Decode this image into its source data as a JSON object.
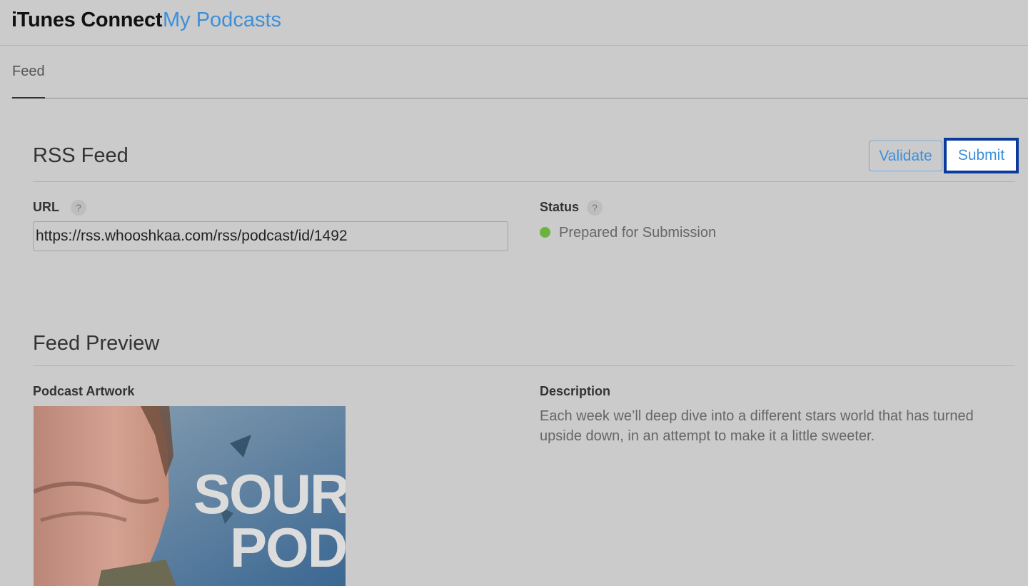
{
  "header": {
    "brand": "iTunes Connect",
    "section": "My Podcasts"
  },
  "tabs": [
    {
      "label": "Feed",
      "active": true
    }
  ],
  "rss_feed": {
    "title": "RSS Feed",
    "validate_label": "Validate",
    "submit_label": "Submit",
    "url_label": "URL",
    "url_value": "https://rss.whooshkaa.com/rss/podcast/id/1492",
    "status_label": "Status",
    "status_value": "Prepared for Submission",
    "status_color": "#6cb33e",
    "help_glyph": "?"
  },
  "feed_preview": {
    "title": "Feed Preview",
    "artwork_label": "Podcast Artwork",
    "artwork_text": [
      "SOUR",
      "POD"
    ],
    "description_label": "Description",
    "description": "Each week we’ll deep dive into a different stars world that has turned upside down, in an attempt to make it a little sweeter."
  },
  "colors": {
    "accent": "#3d8fd9",
    "focus_outline": "#0a3a9c",
    "background": "#cbcbcb"
  }
}
